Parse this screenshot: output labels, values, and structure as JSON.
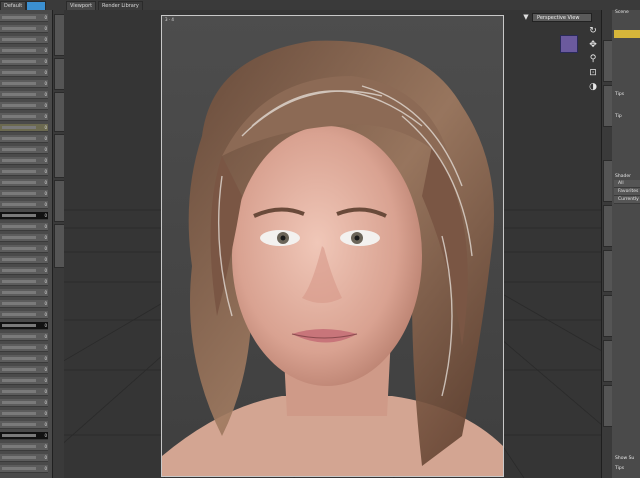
{
  "tabs": {
    "default": "Default",
    "viewport": "Viewport",
    "render_library": "Render Library"
  },
  "viewport": {
    "frame_label": "3 · 4",
    "view_name": "Perspective View",
    "view_icon": "camera-icon"
  },
  "left_panel": {
    "values": [
      "0",
      "0",
      "0",
      "0",
      "0",
      "0",
      "0",
      "0",
      "0",
      "0",
      "0",
      "0",
      "0",
      "0",
      "0",
      "0",
      "0",
      "0",
      "0",
      "0",
      "0",
      "0",
      "0",
      "0",
      "0",
      "0",
      "0",
      "0",
      "0",
      "0",
      "0",
      "0",
      "0",
      "0",
      "0",
      "0",
      "0",
      "0",
      "0",
      "0",
      "0",
      "0"
    ]
  },
  "right_panel": {
    "scene": "Scene",
    "tips": "Tips",
    "filter": "Tip",
    "shader": "Shader",
    "all": "All",
    "favorites": "Favorites",
    "currently": "Currently",
    "show_sub": "Show Su",
    "tips_bottom": "Tips"
  },
  "colors": {
    "accent_gold": "#d7b63a",
    "nav_cube": "#6b5a9e",
    "frame_border": "#c8c8c8"
  }
}
